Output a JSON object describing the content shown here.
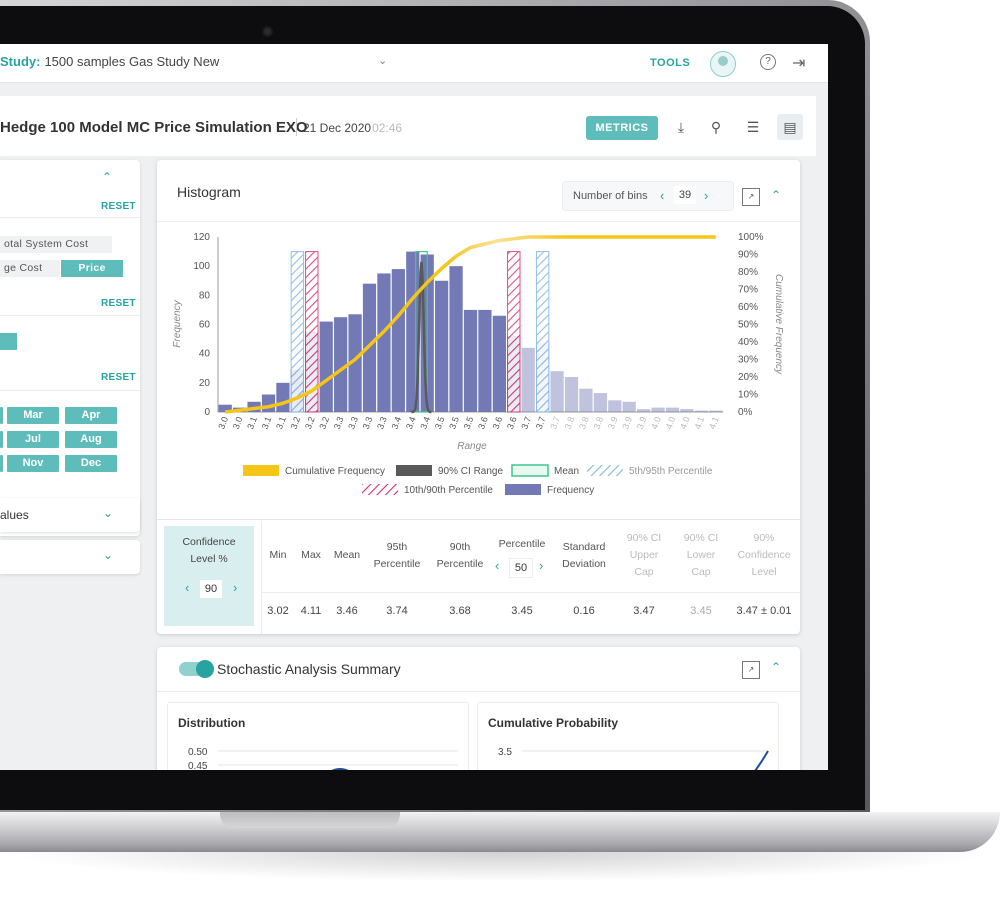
{
  "topbar": {
    "study_key": "Study:",
    "study_name": "1500 samples Gas Study New",
    "tools_label": "TOOLS"
  },
  "model": {
    "title": "Hedge 100 Model MC Price Simulation EXO",
    "date": "21 Dec 2020",
    "time": "02:46",
    "metrics_label": "METRICS"
  },
  "left_panel": {
    "reset_label": "RESET",
    "chips": [
      "otal System Cost",
      "ge Cost",
      "Price"
    ],
    "months": [
      "Mar",
      "Apr",
      "Jul",
      "Aug",
      "Nov",
      "Dec"
    ],
    "accordions": [
      "alues",
      ""
    ]
  },
  "histogram": {
    "title": "Histogram",
    "bins_label": "Number of bins",
    "bins_value": "39"
  },
  "chart_data": {
    "type": "bar",
    "ylabel": "Frequency",
    "y2label": "Cumulative Frequency",
    "xlabel": "Range",
    "ylim": [
      0,
      120
    ],
    "y_ticks": [
      "0",
      "20",
      "40",
      "60",
      "80",
      "100",
      "120"
    ],
    "y2_ticks": [
      "0%",
      "10%",
      "20%",
      "30%",
      "40%",
      "50%",
      "60%",
      "70%",
      "80%",
      "90%",
      "100%"
    ],
    "categories": [
      "3.0",
      "3.0",
      "3.1",
      "3.1",
      "3.1",
      "3.2",
      "3.2",
      "3.2",
      "3.3",
      "3.3",
      "3.3",
      "3.3",
      "3.4",
      "3.4",
      "3.4",
      "3.5",
      "3.5",
      "3.5",
      "3.6",
      "3.6",
      "3.6",
      "3.7",
      "3.7",
      "3.7",
      "3.8",
      "3.8",
      "3.8",
      "3.9",
      "3.9",
      "3.9",
      "4.0",
      "4.0",
      "4.0",
      "4.1",
      "4.1"
    ],
    "series": [
      {
        "name": "Frequency",
        "values": [
          5,
          3,
          7,
          12,
          20,
          29,
          55,
          62,
          65,
          67,
          88,
          95,
          98,
          110,
          108,
          90,
          100,
          70,
          70,
          66,
          52,
          44,
          47,
          28,
          24,
          16,
          13,
          8,
          7,
          2,
          3,
          3,
          2,
          1,
          1
        ]
      },
      {
        "name": "Cumulative Frequency",
        "values": [
          0,
          1,
          2,
          3,
          5,
          8,
          12,
          18,
          24,
          30,
          38,
          46,
          55,
          65,
          74,
          82,
          89,
          94,
          96,
          98,
          99,
          100,
          100,
          100,
          100,
          100,
          100,
          100,
          100,
          100,
          100,
          100,
          100,
          100,
          100
        ]
      }
    ],
    "legend": [
      "Cumulative Frequency",
      "90% CI Range",
      "Mean",
      "5th/95th Percentile",
      "10th/90th Percentile",
      "Frequency"
    ],
    "colors": {
      "frequency": "#7279b4",
      "cumulative": "#f5c518",
      "ci": "#5a5a5a",
      "mean": "#3cc98f",
      "p5_95": "#7fb5e8",
      "p10_90": "#d6336c"
    }
  },
  "stats": {
    "confidence_label_1": "Confidence",
    "confidence_label_2": "Level %",
    "confidence_value": "90",
    "percentile_value": "50",
    "headers": [
      {
        "l1": "Min",
        "l2": "",
        "l3": ""
      },
      {
        "l1": "Max",
        "l2": "",
        "l3": ""
      },
      {
        "l1": "Mean",
        "l2": "",
        "l3": ""
      },
      {
        "l1": "95th",
        "l2": "Percentile",
        "l3": ""
      },
      {
        "l1": "90th",
        "l2": "Percentile",
        "l3": ""
      },
      {
        "l1": "Percentile",
        "l2": "",
        "l3": ""
      },
      {
        "l1": "Standard",
        "l2": "Deviation",
        "l3": ""
      },
      {
        "l1": "90% CI",
        "l2": "Upper",
        "l3": "Cap"
      },
      {
        "l1": "90% CI",
        "l2": "Lower",
        "l3": "Cap"
      },
      {
        "l1": "90%",
        "l2": "Confidence",
        "l3": "Level"
      }
    ],
    "values": [
      "3.02",
      "4.11",
      "3.46",
      "3.74",
      "3.68",
      "3.45",
      "0.16",
      "3.47",
      "3.45",
      "3.47 ± 0.01"
    ]
  },
  "stochastic": {
    "title": "Stochastic Analysis Summary",
    "distribution_title": "Distribution",
    "cumulative_title": "Cumulative Probability",
    "dist_ticks": [
      "0.50",
      "0.45"
    ],
    "cum_ticks": [
      "3.5"
    ]
  }
}
